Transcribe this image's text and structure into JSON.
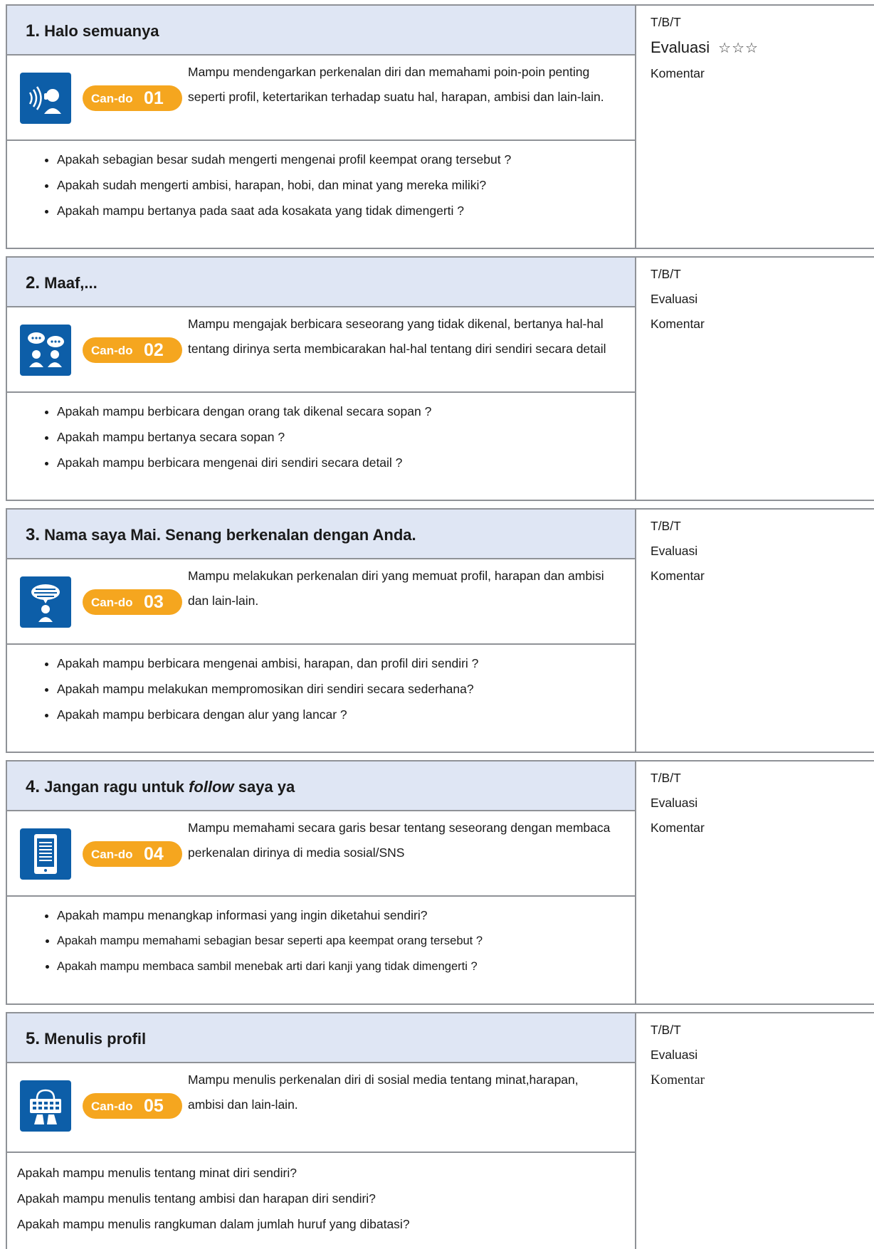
{
  "lessons": [
    {
      "number": "1.",
      "title": "Halo semuanya",
      "cando_label": "Can-do",
      "cando_number": "01",
      "icon": "listening-icon",
      "description": "Mampu mendengarkan perkenalan diri dan memahami poin-poin penting seperti profil, ketertarikan terhadap suatu hal, harapan, ambisi dan lain-lain.",
      "checks": [
        "Apakah sebagian besar sudah mengerti mengenai profil keempat orang tersebut ?",
        "Apakah sudah mengerti ambisi, harapan, hobi, dan minat yang mereka miliki?",
        "Apakah mampu bertanya pada saat ada kosakata yang tidak dimengerti ?"
      ],
      "side": {
        "tbt": "T/B/T",
        "evaluasi": "Evaluasi",
        "stars": "☆☆☆",
        "komentar": "Komentar"
      }
    },
    {
      "number": "2.",
      "title": "Maaf,...",
      "cando_label": "Can-do",
      "cando_number": "02",
      "icon": "conversation-icon",
      "description": "Mampu mengajak berbicara seseorang yang tidak dikenal, bertanya hal-hal tentang dirinya serta membicarakan hal-hal tentang diri sendiri secara detail",
      "checks": [
        "Apakah mampu berbicara dengan orang tak dikenal secara sopan ?",
        "Apakah mampu bertanya secara sopan ?",
        "Apakah mampu berbicara mengenai diri sendiri secara detail ?"
      ],
      "side": {
        "tbt": "T/B/T",
        "evaluasi": "Evaluasi",
        "komentar": "Komentar"
      }
    },
    {
      "number": "3.",
      "title": "Nama saya Mai. Senang berkenalan dengan Anda.",
      "cando_label": "Can-do",
      "cando_number": "03",
      "icon": "speaking-icon",
      "description": "Mampu melakukan perkenalan diri yang memuat profil, harapan dan ambisi dan lain-lain.",
      "checks": [
        "Apakah mampu berbicara mengenai ambisi, harapan, dan profil diri sendiri ?",
        "Apakah mampu melakukan mempromosikan diri sendiri secara sederhana?",
        "Apakah mampu berbicara dengan alur yang lancar ?"
      ],
      "side": {
        "tbt": "T/B/T",
        "evaluasi": "Evaluasi",
        "komentar": "Komentar"
      }
    },
    {
      "number": "4.",
      "title_before": "Jangan ragu untuk ",
      "title_italic": "follow",
      "title_after": " saya ya",
      "cando_label": "Can-do",
      "cando_number": "04",
      "icon": "reading-tablet-icon",
      "description": "Mampu memahami secara garis besar tentang seseorang dengan membaca perkenalan dirinya di media sosial/SNS",
      "checks": [
        "Apakah mampu menangkap informasi yang ingin diketahui sendiri?",
        "Apakah mampu memahami sebagian besar seperti apa keempat orang tersebut ?",
        "Apakah mampu membaca sambil menebak arti dari kanji yang tidak dimengerti ?"
      ],
      "side": {
        "tbt": "T/B/T",
        "evaluasi": "Evaluasi",
        "komentar": "Komentar"
      }
    },
    {
      "number": "5.",
      "title": "Menulis profil",
      "cando_label": "Can-do",
      "cando_number": "05",
      "icon": "typing-keyboard-icon",
      "description": "Mampu menulis perkenalan diri di sosial media tentang minat,harapan, ambisi dan lain-lain.",
      "checks": [
        "Apakah mampu menulis tentang minat diri sendiri?",
        "Apakah mampu menulis tentang ambisi dan harapan diri sendiri?",
        "Apakah mampu menulis rangkuman dalam jumlah huruf yang dibatasi?"
      ],
      "side": {
        "tbt": "T/B/T",
        "evaluasi": "Evaluasi",
        "komentar": "Komentar"
      }
    }
  ],
  "colors": {
    "title_bg": "#dfe6f4",
    "icon_bg": "#0d5ea8",
    "badge_bg": "#f5a61f",
    "border": "#8f9297"
  }
}
